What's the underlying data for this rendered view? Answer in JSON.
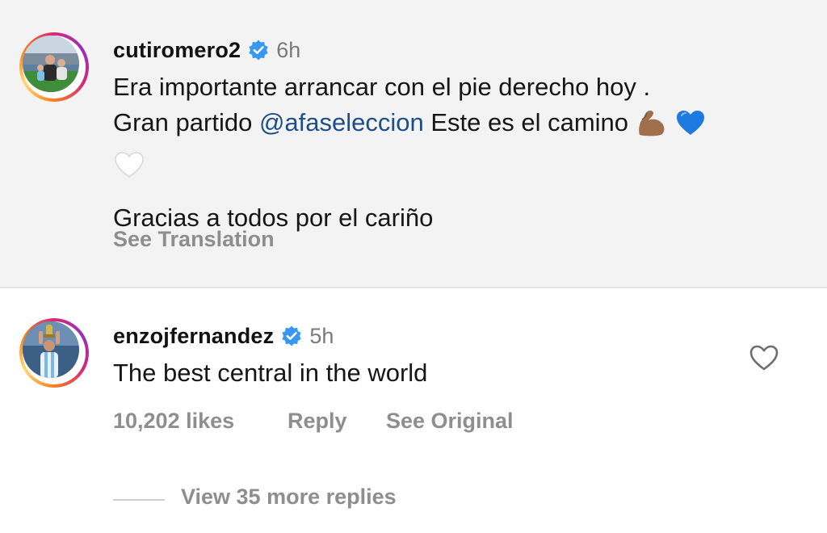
{
  "post_caption": {
    "username": "cutiromero2",
    "time": "6h",
    "line1": "Era importante arrancar con el pie derecho hoy .",
    "line2_start": "Gran partido ",
    "mention": "@afaseleccion",
    "line2_end": " Este es el camino",
    "emojis": [
      "flexed-biceps-emoji",
      "blue-heart-emoji",
      "white-heart-emoji"
    ],
    "line4": "Gracias a todos por el cariño",
    "see_translation": "See Translation"
  },
  "comment": {
    "username": "enzojfernandez",
    "time": "5h",
    "text": "The best central in the world",
    "likes": "10,202 likes",
    "reply": "Reply",
    "see_original": "See Original",
    "view_replies": "View 35 more replies"
  },
  "colors": {
    "caption_background": "#f3f3f3",
    "verified_badge": "#3897f0",
    "mention": "#1d4e89",
    "secondary_text": "#8e8e8e"
  }
}
